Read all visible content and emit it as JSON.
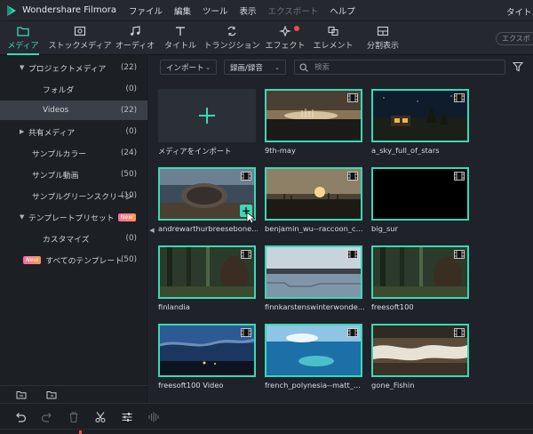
{
  "app": {
    "name": "Wondershare Filmora",
    "title_right": "タイトル"
  },
  "menu": [
    "ファイル",
    "編集",
    "ツール",
    "表示",
    "エクスポート",
    "ヘルプ"
  ],
  "toolbar": {
    "tabs": [
      "メディア",
      "ストックメディア",
      "オーディオ",
      "タイトル",
      "トランジション",
      "エフェクト",
      "エレメント",
      "分割表示"
    ],
    "active_tab": "メディア",
    "export_pill": "エクスポ"
  },
  "sidebar": {
    "items": [
      {
        "label": "プロジェクトメディア",
        "count": "(22)",
        "caret": "▼"
      },
      {
        "label": "フォルダ",
        "count": "(0)"
      },
      {
        "label": "Videos",
        "count": "(22)"
      },
      {
        "label": "共有メディア",
        "count": "(0)",
        "caret": "▶"
      },
      {
        "label": "サンプルカラー",
        "count": "(24)"
      },
      {
        "label": "サンプル動画",
        "count": "(50)"
      },
      {
        "label": "サンプルグリーンスクリーン",
        "count": "(10)"
      },
      {
        "label": "テンプレートプリセット",
        "caret": "▼",
        "badge": "New"
      },
      {
        "label": "カスタマイズ",
        "count": "(0)"
      },
      {
        "label": "すべてのテンプレート",
        "count": "(50)",
        "badge": "New"
      }
    ]
  },
  "filter": {
    "import_label": "インポート",
    "record_label": "録画/録音",
    "search_placeholder": "検索"
  },
  "media": {
    "import_label": "メディアをインポート",
    "items": [
      "9th-may",
      "a_sky_full_of_stars",
      "andrewarthurbreesebone...",
      "benjamin_wu--raccoon_c...",
      "big_sur",
      "finlandia",
      "finnkarstenswinterwonde...",
      "freesoft100",
      "freesoft100 Video",
      "french_polynesia--matt_...",
      "gone_Fishin"
    ]
  },
  "colors": {
    "accent": "#39d9b5",
    "badge": "#f76b9a",
    "notification": "#e5514a"
  }
}
